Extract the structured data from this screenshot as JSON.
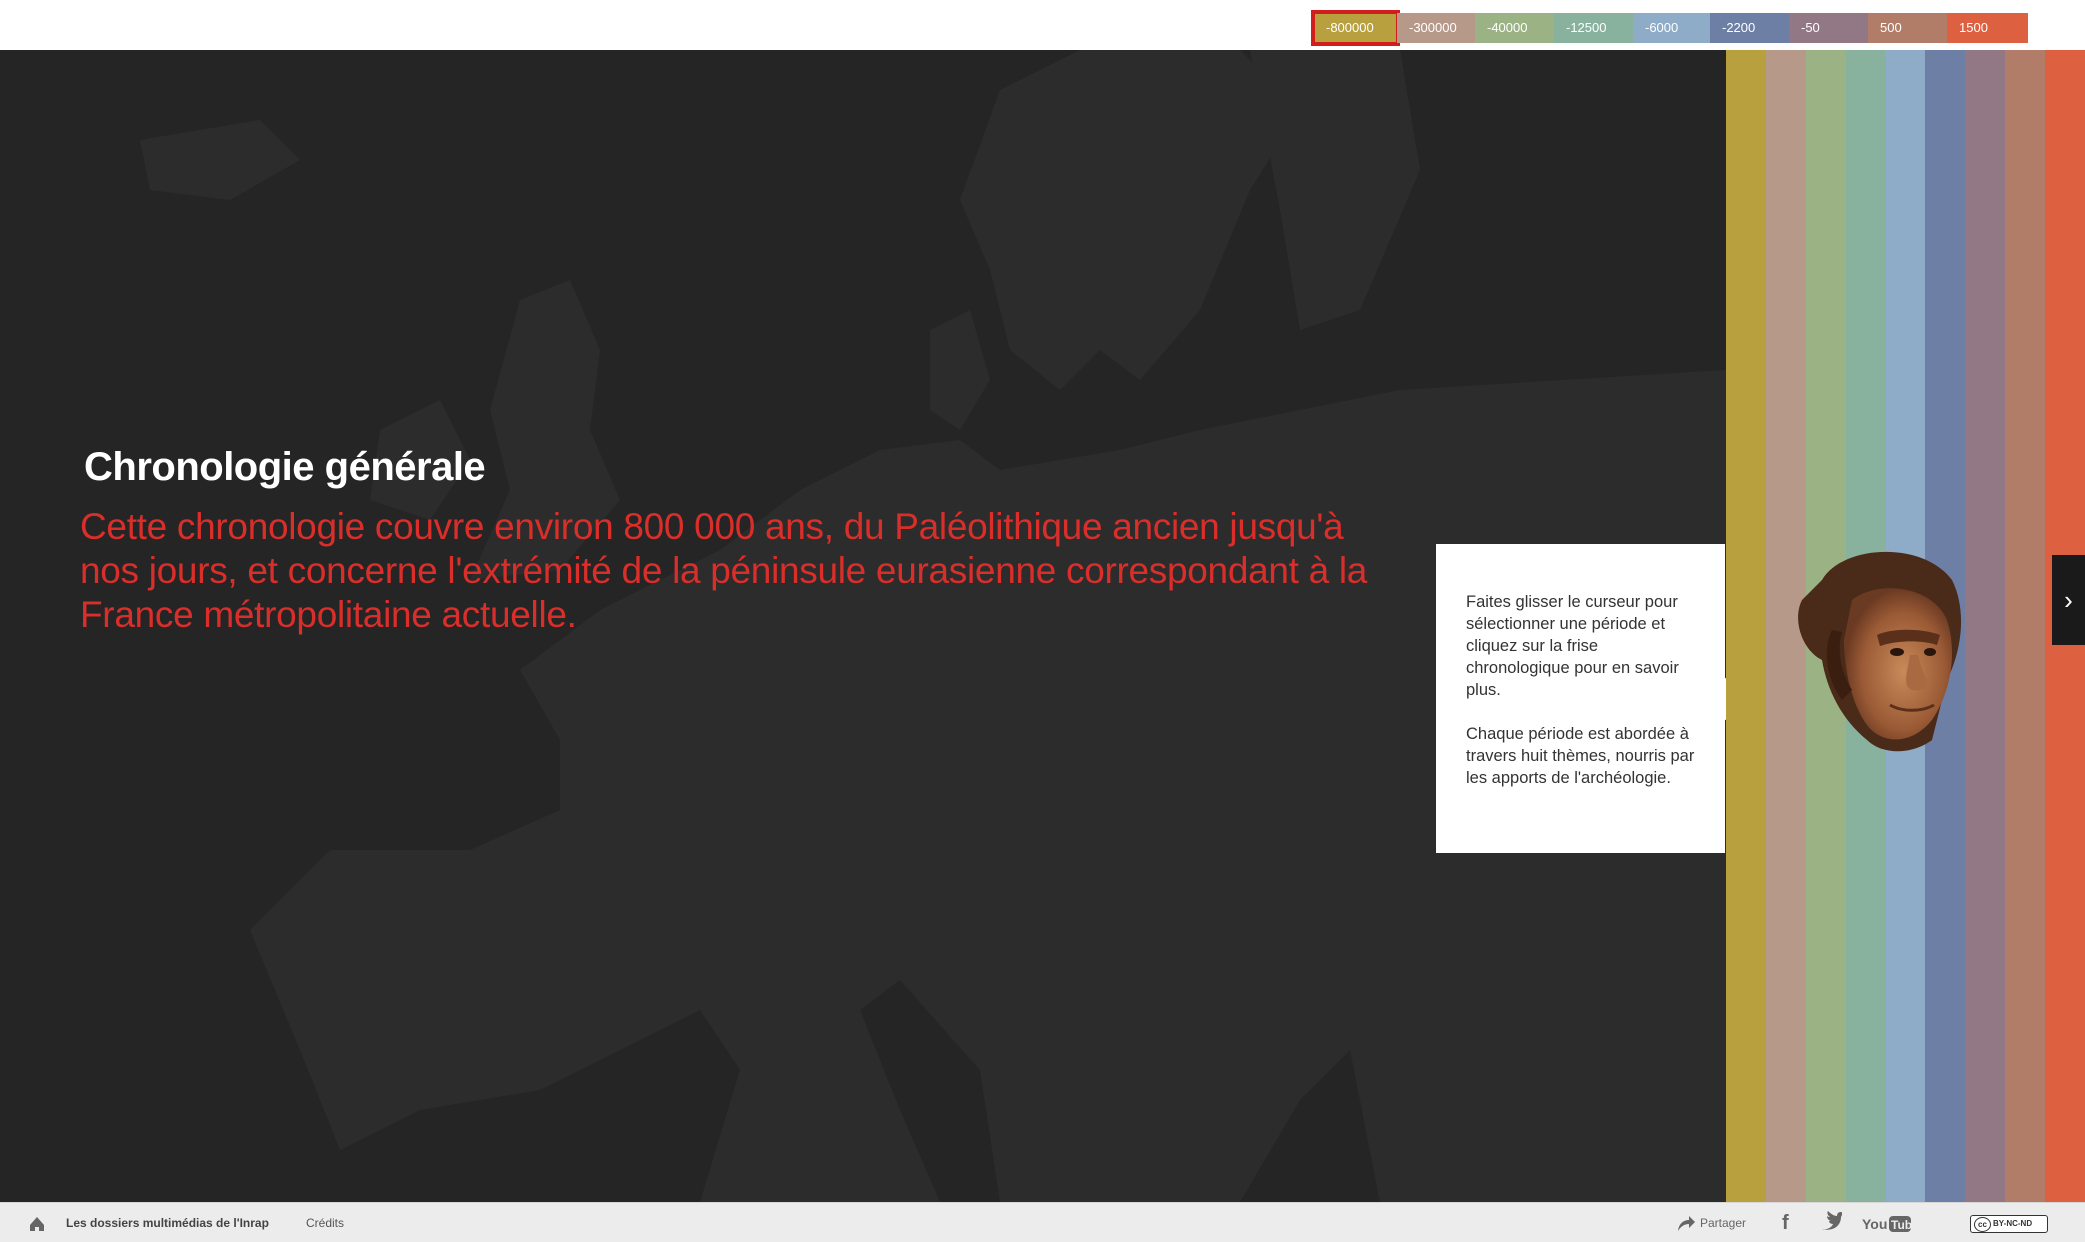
{
  "timeline": {
    "tabs": [
      {
        "label": "-800000",
        "color": "#b9a03f",
        "active": true
      },
      {
        "label": "-300000",
        "color": "#b7998a",
        "active": false
      },
      {
        "label": "-40000",
        "color": "#9bb384",
        "active": false
      },
      {
        "label": "-12500",
        "color": "#88b29e",
        "active": false
      },
      {
        "label": "-6000",
        "color": "#8eabc8",
        "active": false
      },
      {
        "label": "-2200",
        "color": "#6e7fa6",
        "active": false
      },
      {
        "label": "-50",
        "color": "#927785",
        "active": false
      },
      {
        "label": "500",
        "color": "#b27d68",
        "active": false
      },
      {
        "label": "1500",
        "color": "#dd6140",
        "active": false
      }
    ],
    "active_outline_color": "#d21d1d"
  },
  "main": {
    "title": "Chronologie générale",
    "intro": "Cette chronologie couvre environ 800 000 ans, du Paléolithique ancien jusqu'à nos jours, et concerne l'extrémité de la péninsule eurasienne correspondant à la France métropolitaine actuelle.",
    "intro_color": "#d92e2a",
    "background_color": "#252525",
    "landmass_color": "#2d2d2d"
  },
  "hint": {
    "paragraph_1": "Faites glisser le curseur pour sélectionner une période et cliquez sur la frise chronologique pour en savoir plus.",
    "paragraph_2": "Chaque période est abordée à travers huit thèmes, nourris par les apports de l'archéologie."
  },
  "stripes": {
    "colors": [
      "#b9a03f",
      "#b7998a",
      "#9bb384",
      "#88b29e",
      "#8eabc8",
      "#6e7fa6",
      "#927785",
      "#b27d68",
      "#dd6140"
    ]
  },
  "figure": {
    "icon": "hominid-head-illustration"
  },
  "navigation": {
    "next_icon": "chevron-right-icon",
    "next_glyph": "›"
  },
  "footer": {
    "home_icon": "home-icon",
    "brand": "Les dossiers multimédias de l'Inrap",
    "credits": "Crédits",
    "share_label": "Partager",
    "facebook_glyph": "f",
    "license": "BY-NC-ND"
  }
}
